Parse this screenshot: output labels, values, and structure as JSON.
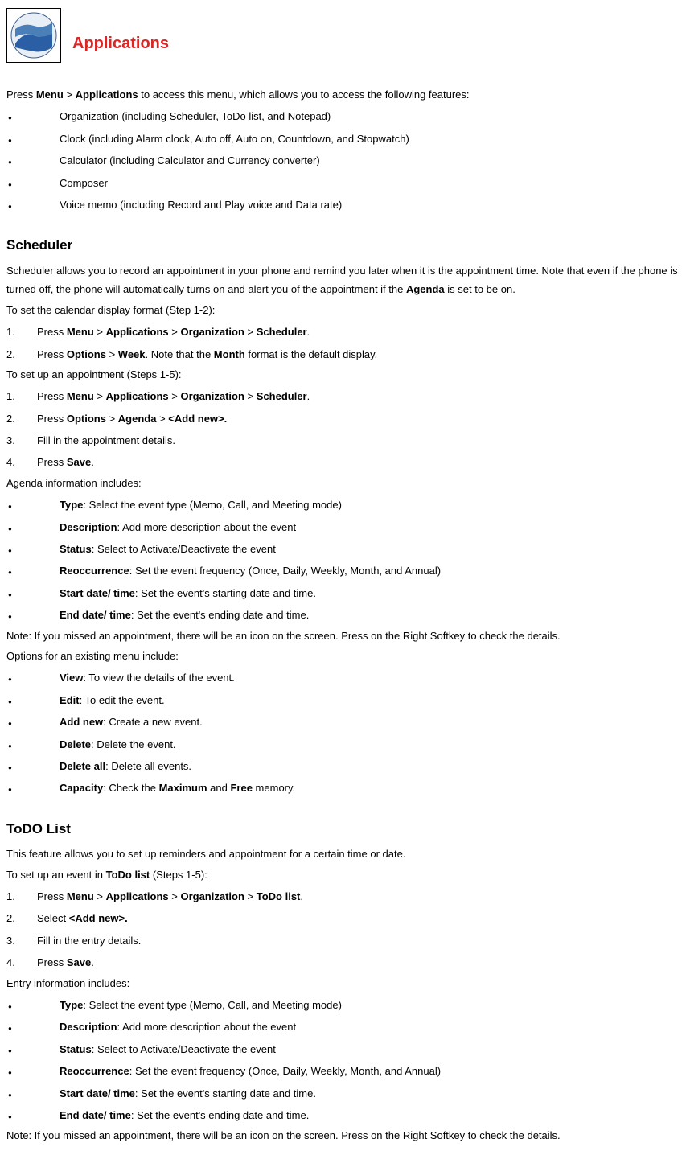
{
  "title": "Applications",
  "intro_html": "Press <b>Menu</b> > <b>Applications</b> to access this menu, which allows you to access the following features:",
  "top_bullets": [
    "Organization (including Scheduler, ToDo list, and Notepad)",
    "Clock (including Alarm clock, Auto off, Auto on, Countdown, and Stopwatch)",
    "Calculator (including Calculator and Currency converter)",
    "Composer",
    "Voice memo (including Record and Play voice and Data rate)"
  ],
  "scheduler": {
    "heading": "Scheduler",
    "desc_html": "Scheduler allows you to record an appointment in your phone and remind you later when it is the appointment time. Note that even if the phone is turned off, the phone will automatically turns on and alert you of the appointment if the <b>Agenda</b> is set to be on.",
    "calendar_intro": "To set the calendar display format (Step 1-2):",
    "calendar_steps": [
      "Press <b>Menu</b> > <b>Applications</b> > <b>Organization</b> > <b>Scheduler</b>.",
      "Press <b>Options</b> > <b>Week</b>. Note that the <b>Month</b> format is the default display."
    ],
    "appt_intro": "To set up an appointment (Steps 1-5):",
    "appt_steps": [
      "Press <b>Menu</b> > <b>Applications</b> > <b>Organization</b> > <b>Scheduler</b>.",
      "Press <b>Options</b> > <b>Agenda</b> > <b>&lt;Add new&gt;.</b>",
      "Fill in the appointment details.",
      "Press <b>Save</b>."
    ],
    "agenda_intro": "Agenda information includes:",
    "agenda_bullets": [
      "<b>Type</b>: Select the event type (Memo, Call, and Meeting mode)",
      "<b>Description</b>: Add more description about the event",
      "<b>Status</b>: Select to Activate/Deactivate the event",
      "<b>Reoccurrence</b>: Set the event frequency (Once, Daily, Weekly, Month, and Annual)",
      "<b>Start date/ time</b>: Set the event's starting date and time.",
      "<b>End date/ time</b>: Set the event's ending date and time."
    ],
    "note": "Note: If you missed an appointment, there will be an icon on the screen. Press on the Right Softkey to check the details.",
    "options_intro": "Options for an existing menu include:",
    "options_bullets": [
      "<b>View</b>: To view the details of the event.",
      "<b>Edit</b>: To edit the event.",
      "<b>Add new</b>: Create a new event.",
      "<b>Delete</b>: Delete the event.",
      "<b>Delete all</b>: Delete all events.",
      "<b>Capacity</b>: Check the <b>Maximum</b> and <b>Free</b> memory."
    ]
  },
  "todo": {
    "heading": "ToDO List",
    "desc": "This feature allows you to set up reminders and appointment for a certain time or date.",
    "setup_intro_html": "To set up an event in <b>ToDo list</b> (Steps 1-5):",
    "steps": [
      "Press <b>Menu</b> > <b>Applications</b> > <b>Organization</b> > <b>ToDo list</b>.",
      "Select <b>&lt;Add new&gt;.</b>",
      "Fill in the entry details.",
      "Press <b>Save</b>."
    ],
    "entry_intro": "Entry information includes:",
    "entry_bullets": [
      "<b>Type</b>: Select the event type (Memo, Call, and Meeting mode)",
      "<b>Description</b>: Add more description about the event",
      "<b>Status</b>: Select to Activate/Deactivate the event",
      "<b>Reoccurrence</b>: Set the event frequency (Once, Daily, Weekly, Month, and Annual)",
      "<b>Start date/ time</b>: Set the event's starting date and time.",
      "<b>End date/ time</b>: Set the event's ending date and time."
    ],
    "note": "Note: If you missed an appointment, there will be an icon on the screen. Press on the Right Softkey to check the details."
  }
}
